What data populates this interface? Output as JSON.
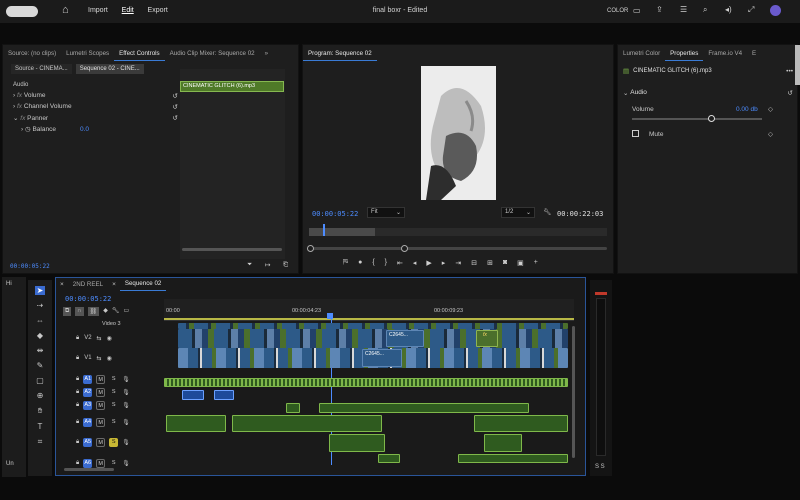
{
  "topbar": {
    "menu": [
      "Import",
      "Edit",
      "Export"
    ],
    "active_menu": "Edit",
    "project_title": "final boxr - Edited",
    "workspace_label": "COLOR"
  },
  "source_panel": {
    "tabs": [
      "Source: (no clips)",
      "Lumetri Scopes",
      "Effect Controls",
      "Audio Clip Mixer: Sequence 02"
    ],
    "active_tab": "Effect Controls",
    "sub_tabs": [
      "Source - CINEMA...",
      "Sequence 02 - CINE..."
    ],
    "section": "Audio",
    "effects": [
      "Volume",
      "Channel Volume",
      "Panner"
    ],
    "balance_label": "Balance",
    "balance_value": "0.0",
    "clip_label": "CINEMATIC GLITCH (6).mp3",
    "timecode": "00:00:05:22"
  },
  "program_panel": {
    "title": "Program: Sequence 02",
    "timecode": "00:00:05:22",
    "fit": "Fit",
    "quality": "1/2",
    "duration": "00:00:22:03"
  },
  "properties_panel": {
    "tabs": [
      "Lumetri Color",
      "Properties",
      "Frame.io V4",
      "E"
    ],
    "active_tab": "Properties",
    "clip_name": "CINEMATIC GLITCH (6).mp3",
    "section": "Audio",
    "volume_label": "Volume",
    "volume_value": "0.00 db",
    "mute_label": "Mute"
  },
  "timeline": {
    "tabs": [
      "2ND REEL",
      "Sequence 02"
    ],
    "active_tab": "Sequence 02",
    "timecode": "00:00:05:22",
    "ruler": [
      "00:00",
      "00:00:04:23",
      "00:00:09:23"
    ],
    "video_tracks": [
      "V2",
      "V1"
    ],
    "video3_label": "Video 3",
    "audio_tracks": [
      "A1",
      "A2",
      "A3",
      "A4",
      "A5",
      "A6"
    ],
    "clip_labels": [
      "C2645...",
      "C2645..."
    ],
    "fx": "fx"
  },
  "left_tools": {
    "his_label": "Hi",
    "un_label": "Un"
  },
  "meter": {
    "label": "S S"
  }
}
